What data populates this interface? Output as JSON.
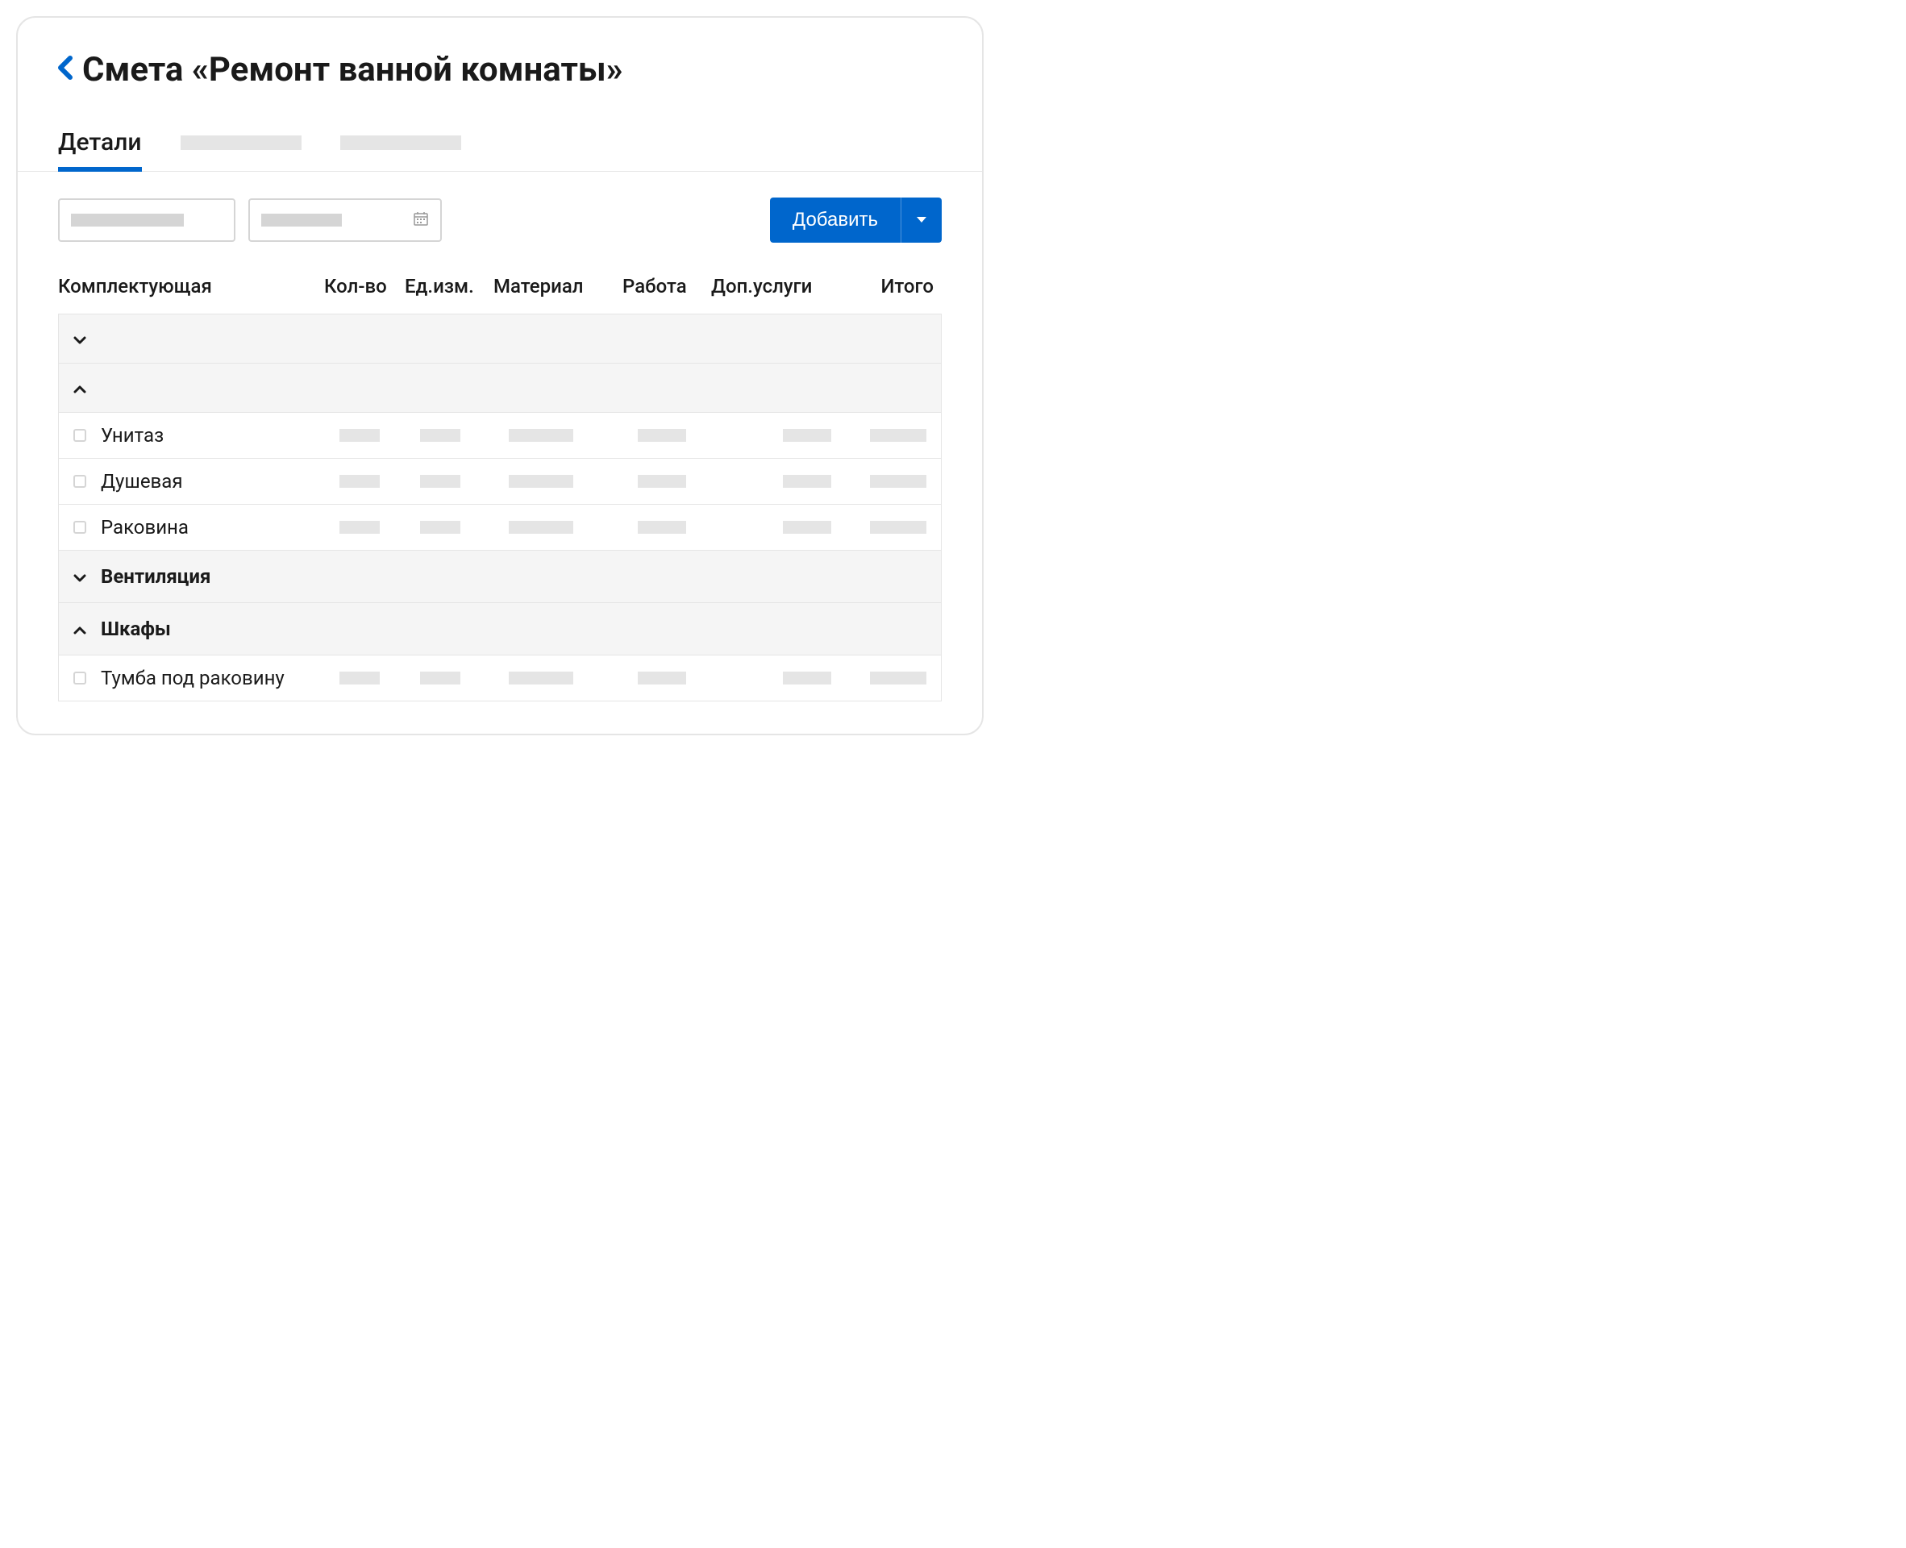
{
  "header": {
    "title": "Смета «Ремонт ванной комнаты»"
  },
  "tabs": {
    "active": "Детали"
  },
  "toolbar": {
    "add_label": "Добавить"
  },
  "table": {
    "columns": {
      "component": "Комплектующая",
      "qty": "Кол-во",
      "unit": "Ед.изм.",
      "material": "Материал",
      "work": "Работа",
      "extra": "Доп.услуги",
      "total": "Итого"
    },
    "groups": [
      {
        "label": "",
        "expanded": false
      },
      {
        "label": "",
        "expanded": true,
        "items": [
          {
            "label": "Унитаз"
          },
          {
            "label": "Душевая"
          },
          {
            "label": "Раковина"
          }
        ]
      },
      {
        "label": "Вентиляция",
        "expanded": false
      },
      {
        "label": "Шкафы",
        "expanded": true,
        "items": [
          {
            "label": "Тумба под раковину"
          }
        ]
      }
    ]
  },
  "colors": {
    "accent": "#0066cc"
  }
}
